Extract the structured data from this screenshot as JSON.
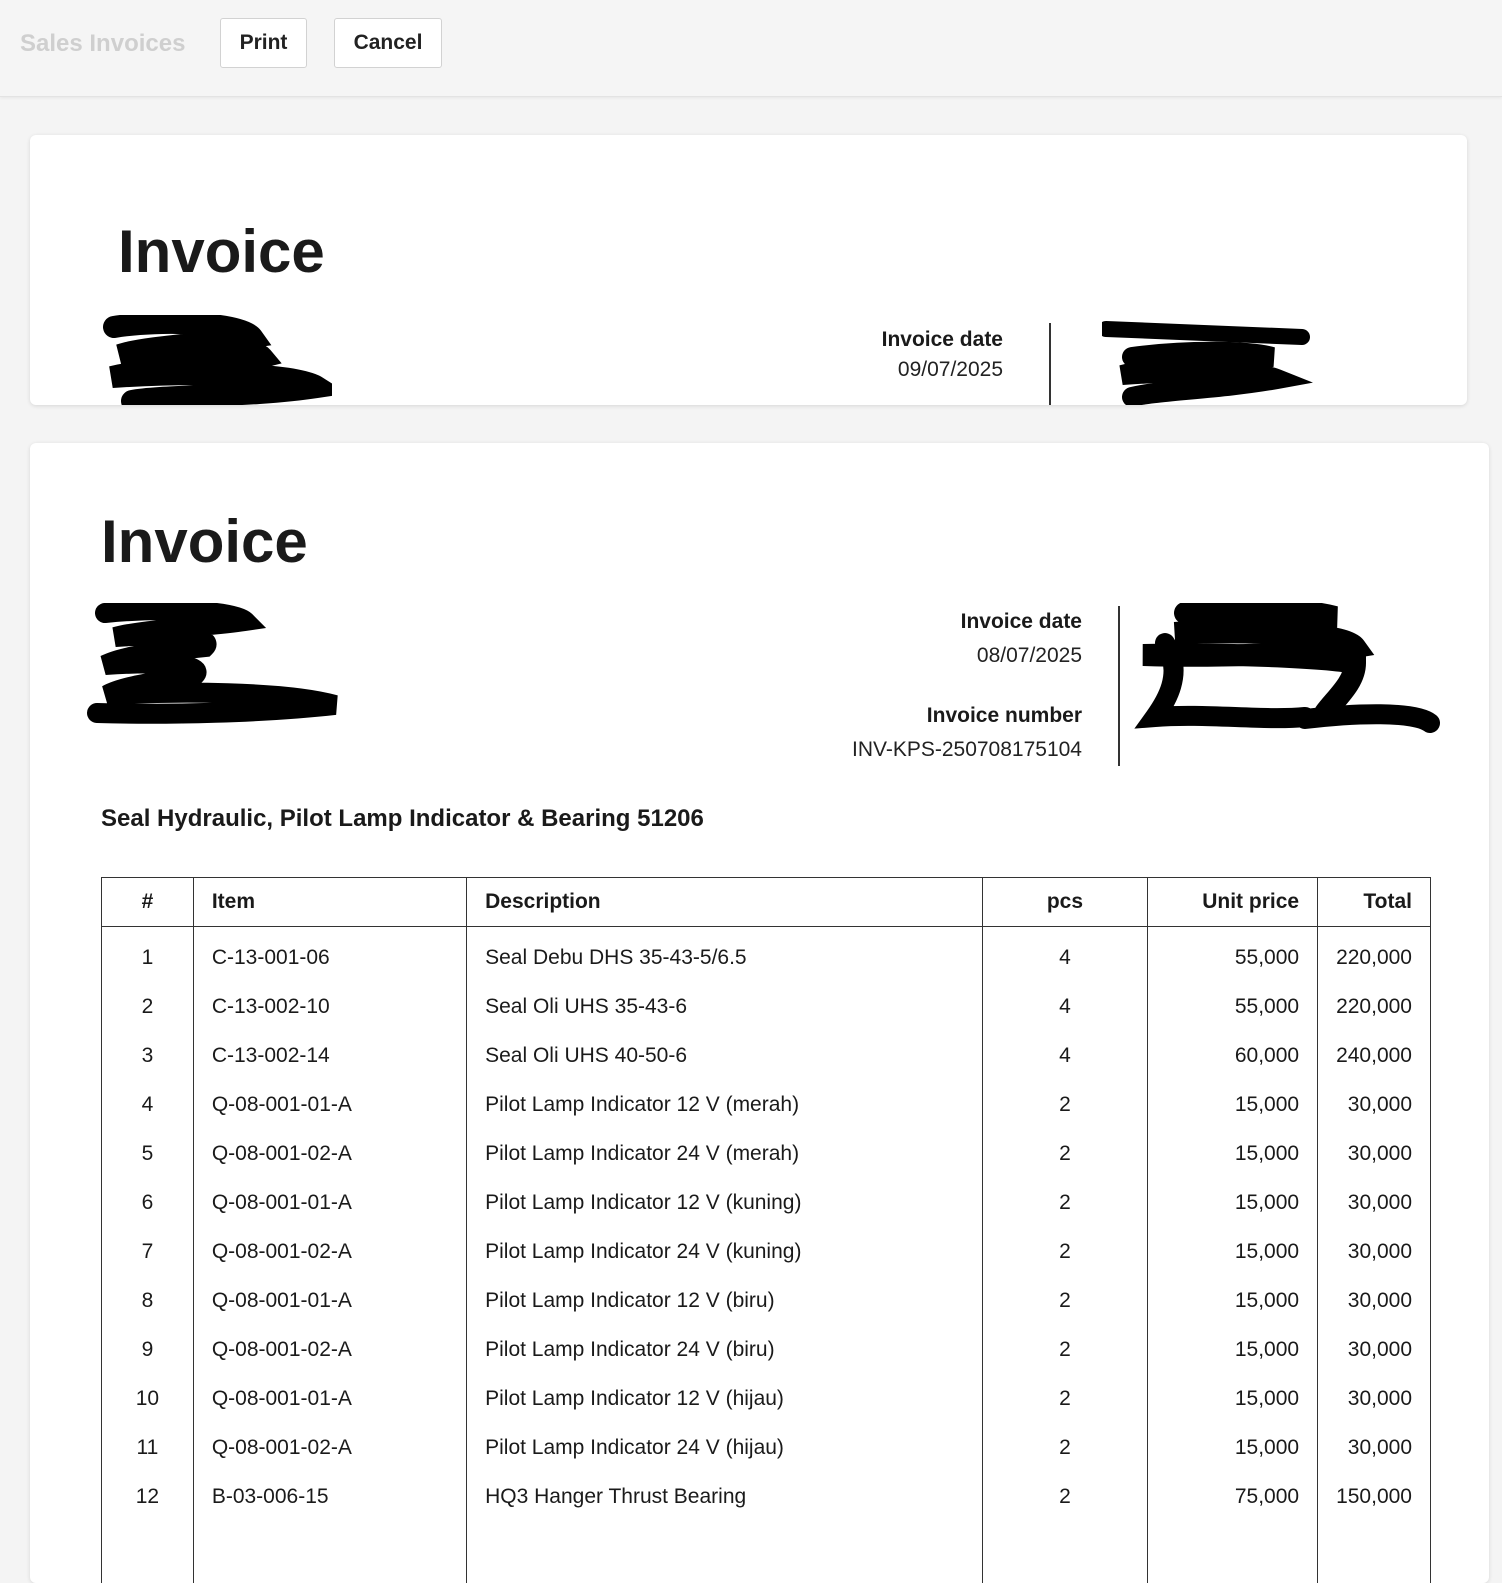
{
  "header": {
    "app_title": "Sales Invoices",
    "print_label": "Print",
    "cancel_label": "Cancel"
  },
  "invoice_preview": {
    "title": "Invoice",
    "invoice_date_label": "Invoice date",
    "invoice_date": "09/07/2025"
  },
  "invoice": {
    "title": "Invoice",
    "invoice_date_label": "Invoice date",
    "invoice_date": "08/07/2025",
    "invoice_number_label": "Invoice number",
    "invoice_number": "INV-KPS-250708175104",
    "subject": "Seal Hydraulic, Pilot Lamp Indicator & Bearing 51206",
    "columns": {
      "num": "#",
      "item": "Item",
      "description": "Description",
      "qty": "pcs",
      "unit_price": "Unit price",
      "total": "Total"
    },
    "rows": [
      {
        "num": "1",
        "item": "C-13-001-06",
        "description": "Seal Debu DHS 35-43-5/6.5",
        "qty": "4",
        "unit_price": "55,000",
        "total": "220,000"
      },
      {
        "num": "2",
        "item": "C-13-002-10",
        "description": "Seal Oli UHS 35-43-6",
        "qty": "4",
        "unit_price": "55,000",
        "total": "220,000"
      },
      {
        "num": "3",
        "item": "C-13-002-14",
        "description": "Seal Oli UHS 40-50-6",
        "qty": "4",
        "unit_price": "60,000",
        "total": "240,000"
      },
      {
        "num": "4",
        "item": "Q-08-001-01-A",
        "description": "Pilot Lamp Indicator 12 V (merah)",
        "qty": "2",
        "unit_price": "15,000",
        "total": "30,000"
      },
      {
        "num": "5",
        "item": "Q-08-001-02-A",
        "description": "Pilot Lamp Indicator 24 V (merah)",
        "qty": "2",
        "unit_price": "15,000",
        "total": "30,000"
      },
      {
        "num": "6",
        "item": "Q-08-001-01-A",
        "description": "Pilot Lamp Indicator 12 V (kuning)",
        "qty": "2",
        "unit_price": "15,000",
        "total": "30,000"
      },
      {
        "num": "7",
        "item": "Q-08-001-02-A",
        "description": "Pilot Lamp Indicator 24 V (kuning)",
        "qty": "2",
        "unit_price": "15,000",
        "total": "30,000"
      },
      {
        "num": "8",
        "item": "Q-08-001-01-A",
        "description": "Pilot Lamp Indicator 12 V (biru)",
        "qty": "2",
        "unit_price": "15,000",
        "total": "30,000"
      },
      {
        "num": "9",
        "item": "Q-08-001-02-A",
        "description": "Pilot Lamp Indicator 24 V (biru)",
        "qty": "2",
        "unit_price": "15,000",
        "total": "30,000"
      },
      {
        "num": "10",
        "item": "Q-08-001-01-A",
        "description": "Pilot Lamp Indicator 12 V (hijau)",
        "qty": "2",
        "unit_price": "15,000",
        "total": "30,000"
      },
      {
        "num": "11",
        "item": "Q-08-001-02-A",
        "description": "Pilot Lamp Indicator 24 V (hijau)",
        "qty": "2",
        "unit_price": "15,000",
        "total": "30,000"
      },
      {
        "num": "12",
        "item": "B-03-006-15",
        "description": "HQ3 Hanger Thrust Bearing",
        "qty": "2",
        "unit_price": "75,000",
        "total": "150,000"
      }
    ]
  }
}
